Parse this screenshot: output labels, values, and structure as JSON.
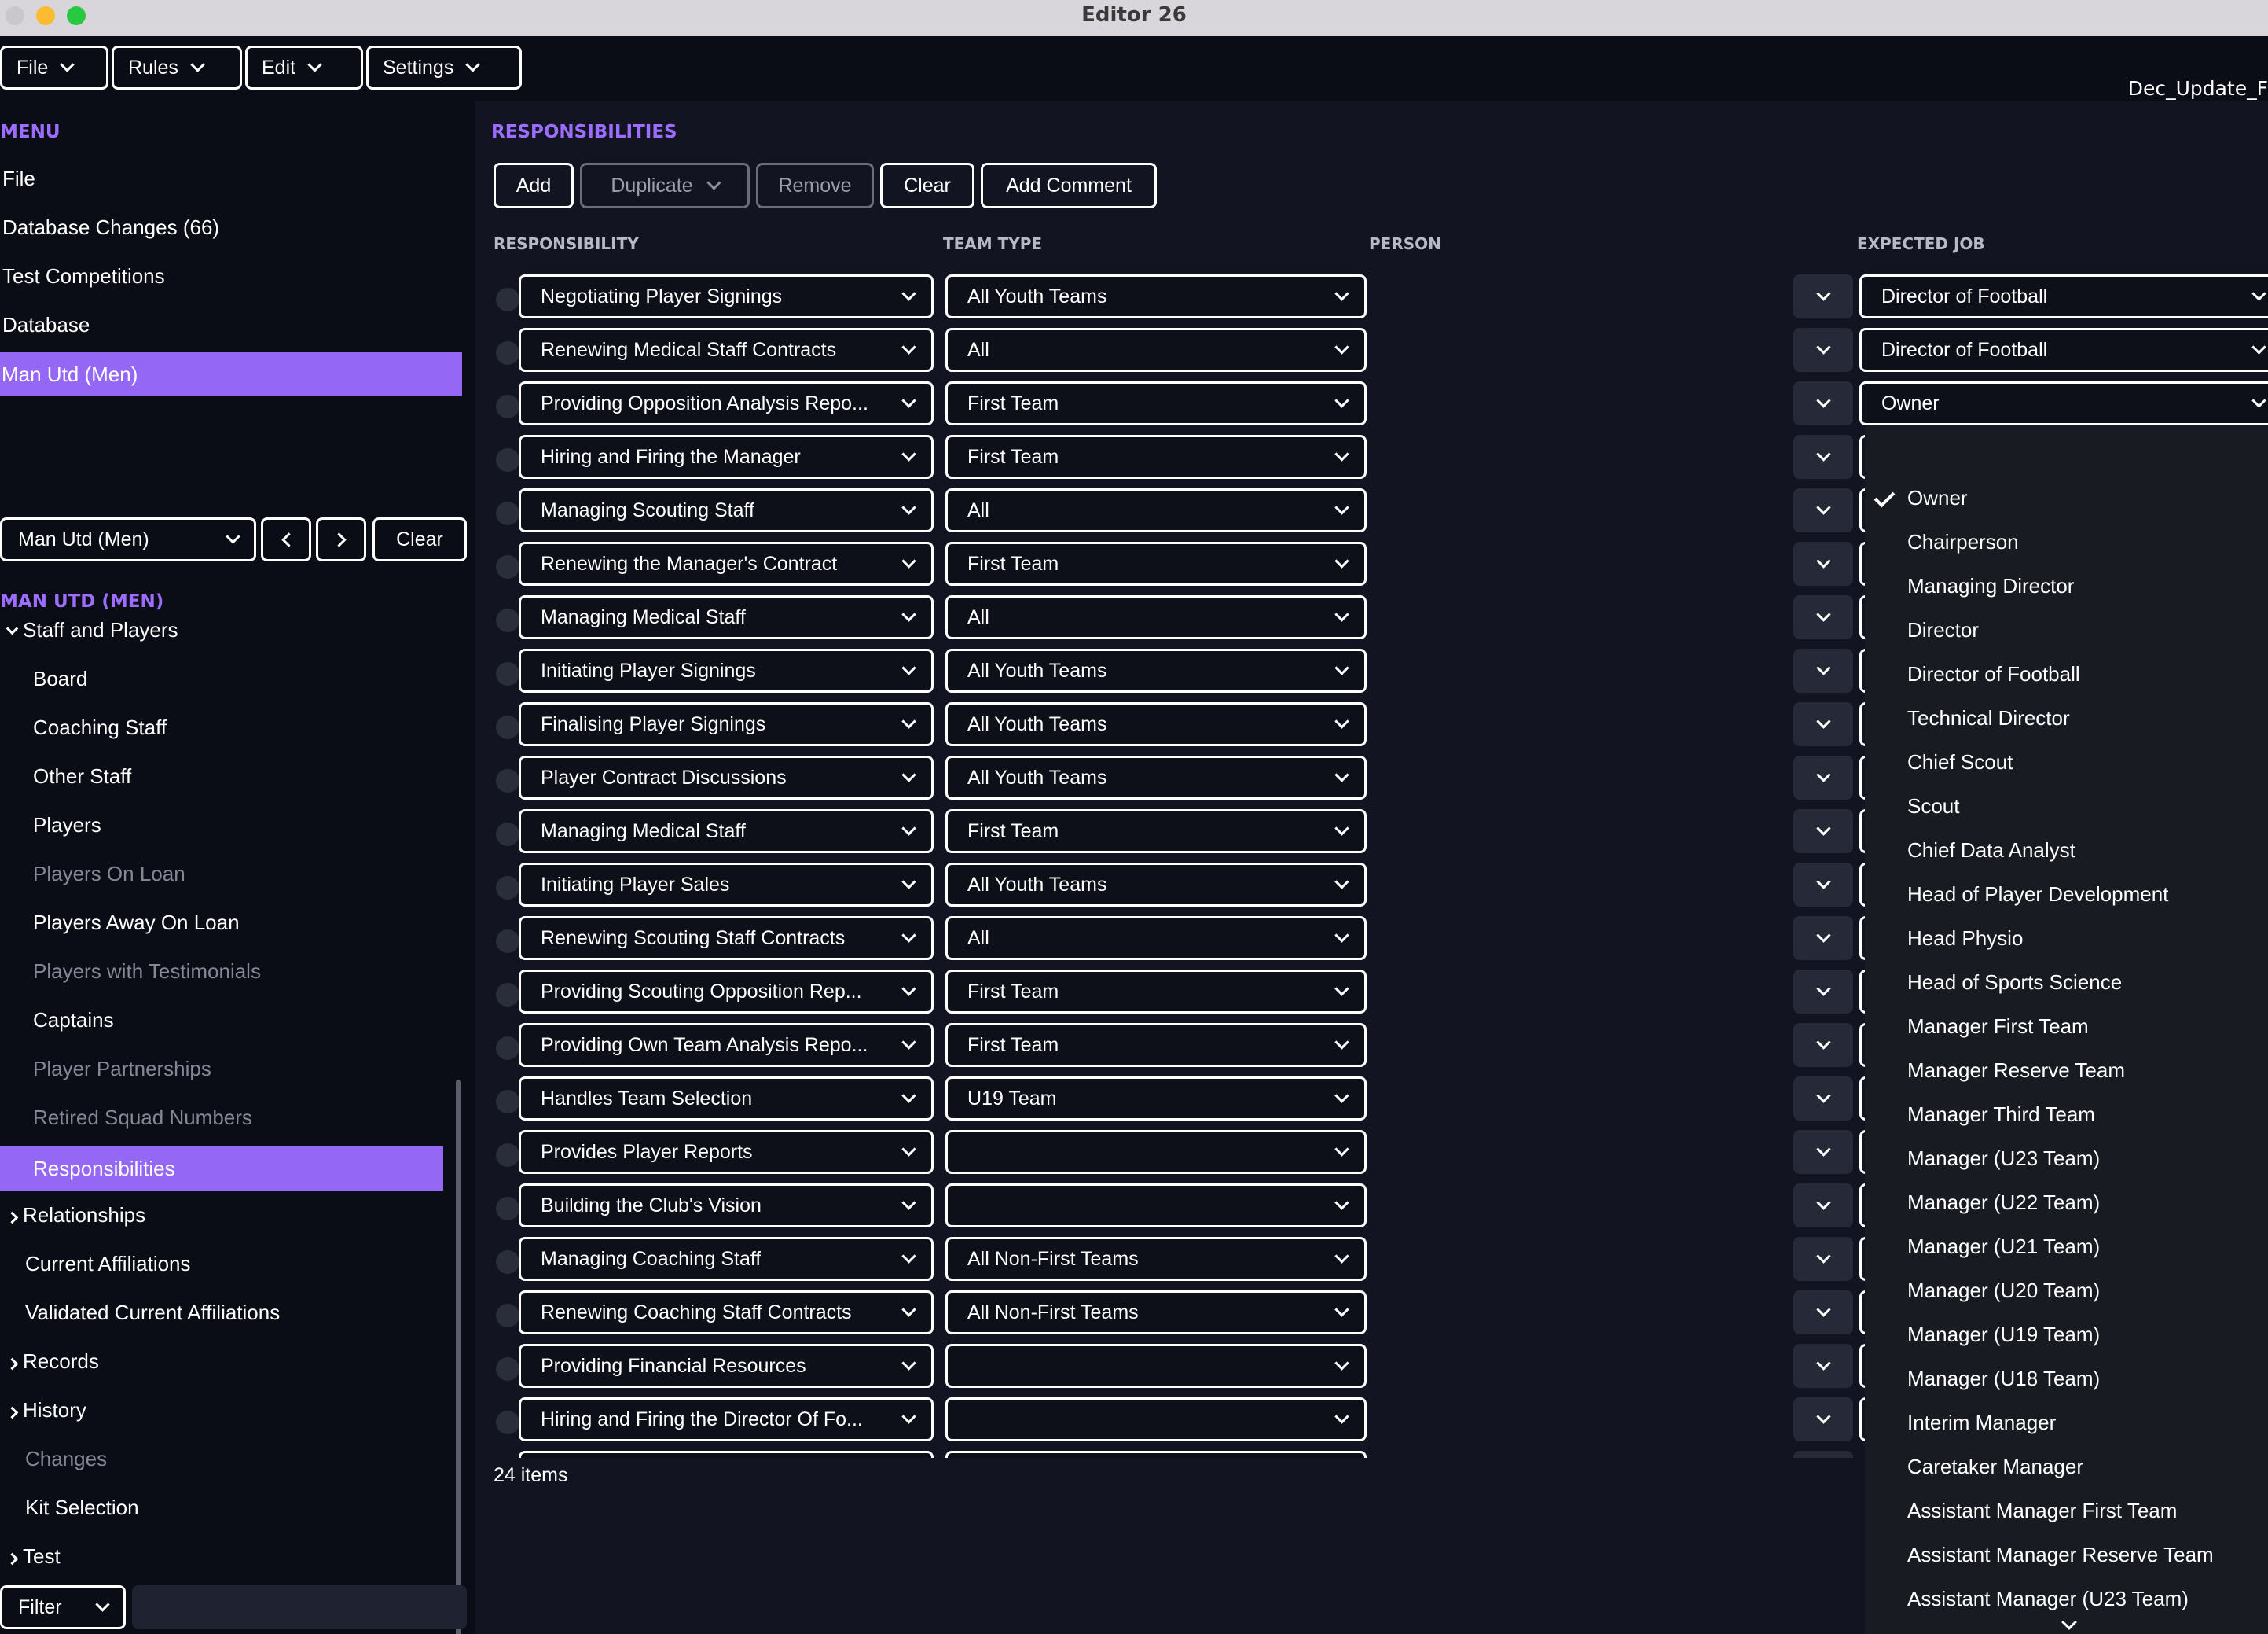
{
  "window": {
    "title": "Editor 26",
    "file_name": "Dec_Update_F"
  },
  "menubar": {
    "file": "File",
    "rules": "Rules",
    "edit": "Edit",
    "settings": "Settings"
  },
  "sidebar": {
    "menu_title": "MENU",
    "menu_items": [
      "File",
      "Database Changes (66)",
      "Test Competitions",
      "Database",
      "Man Utd (Men)"
    ],
    "team_select": "Man Utd (Men)",
    "clear": "Clear",
    "team_title": "MAN UTD (MEN)",
    "tree": {
      "staff_players": "Staff and Players",
      "board": "Board",
      "coaching_staff": "Coaching Staff",
      "other_staff": "Other Staff",
      "players": "Players",
      "players_on_loan": "Players On Loan",
      "players_away": "Players Away On Loan",
      "testimonials": "Players with Testimonials",
      "captains": "Captains",
      "partnerships": "Player Partnerships",
      "retired": "Retired Squad Numbers",
      "responsibilities": "Responsibilities",
      "relationships": "Relationships",
      "current_aff": "Current Affiliations",
      "validated_aff": "Validated Current Affiliations",
      "records": "Records",
      "history": "History",
      "changes": "Changes",
      "kit": "Kit Selection",
      "test": "Test"
    },
    "filter": "Filter"
  },
  "main": {
    "title": "RESPONSIBILITIES",
    "toolbar": {
      "add": "Add",
      "duplicate": "Duplicate",
      "remove": "Remove",
      "clear": "Clear",
      "add_comment": "Add Comment"
    },
    "columns": {
      "responsibility": "RESPONSIBILITY",
      "team_type": "TEAM TYPE",
      "person": "PERSON",
      "expected_job": "EXPECTED JOB"
    },
    "rows": [
      {
        "resp": "Negotiating Player Signings",
        "team": "All Youth Teams",
        "job": "Director of Football"
      },
      {
        "resp": "Renewing Medical Staff Contracts",
        "team": "All",
        "job": "Director of Football"
      },
      {
        "resp": "Providing Opposition Analysis Repo...",
        "team": "First Team",
        "job": "Owner"
      },
      {
        "resp": "Hiring and Firing the Manager",
        "team": "First Team",
        "job": ""
      },
      {
        "resp": "Managing Scouting Staff",
        "team": "All",
        "job": ""
      },
      {
        "resp": "Renewing the Manager's Contract",
        "team": "First Team",
        "job": ""
      },
      {
        "resp": "Managing Medical Staff",
        "team": "All",
        "job": ""
      },
      {
        "resp": "Initiating Player Signings",
        "team": "All Youth Teams",
        "job": ""
      },
      {
        "resp": "Finalising Player Signings",
        "team": "All Youth Teams",
        "job": ""
      },
      {
        "resp": "Player Contract Discussions",
        "team": "All Youth Teams",
        "job": ""
      },
      {
        "resp": "Managing Medical Staff",
        "team": "First Team",
        "job": ""
      },
      {
        "resp": "Initiating Player Sales",
        "team": "All Youth Teams",
        "job": ""
      },
      {
        "resp": "Renewing Scouting Staff Contracts",
        "team": "All",
        "job": ""
      },
      {
        "resp": "Providing Scouting Opposition Rep...",
        "team": "First Team",
        "job": ""
      },
      {
        "resp": "Providing Own Team Analysis Repo...",
        "team": "First Team",
        "job": ""
      },
      {
        "resp": "Handles Team Selection",
        "team": "U19 Team",
        "job": ""
      },
      {
        "resp": "Provides Player Reports",
        "team": "",
        "job": ""
      },
      {
        "resp": "Building the Club's Vision",
        "team": "",
        "job": ""
      },
      {
        "resp": "Managing Coaching Staff",
        "team": "All Non-First Teams",
        "job": ""
      },
      {
        "resp": "Renewing Coaching Staff Contracts",
        "team": "All Non-First Teams",
        "job": ""
      },
      {
        "resp": "Providing Financial Resources",
        "team": "",
        "job": ""
      },
      {
        "resp": "Hiring and Firing the Director Of Fo...",
        "team": "",
        "job": ""
      }
    ],
    "items_count": "24 items"
  },
  "job_dropdown": {
    "selected": "Owner",
    "options": [
      "Owner",
      "Chairperson",
      "Managing Director",
      "Director",
      "Director of Football",
      "Technical Director",
      "Chief Scout",
      "Scout",
      "Chief Data Analyst",
      "Head of Player Development",
      "Head Physio",
      "Head of Sports Science",
      "Manager First Team",
      "Manager Reserve Team",
      "Manager Third Team",
      "Manager (U23 Team)",
      "Manager (U22 Team)",
      "Manager (U21 Team)",
      "Manager (U20 Team)",
      "Manager (U19 Team)",
      "Manager (U18 Team)",
      "Interim Manager",
      "Caretaker Manager",
      "Assistant Manager First Team",
      "Assistant Manager Reserve Team",
      "Assistant Manager (U23 Team)"
    ]
  },
  "icons": {
    "chevron": "chevron-down-icon",
    "check": "check-icon",
    "arrow_left": "arrow-left-icon",
    "arrow_right": "arrow-right-icon",
    "caret": "caret-right-icon"
  },
  "colors": {
    "accent": "#9467f5",
    "heading": "#9d6dff",
    "background": "#121521",
    "sidebar": "#0b0d16"
  }
}
